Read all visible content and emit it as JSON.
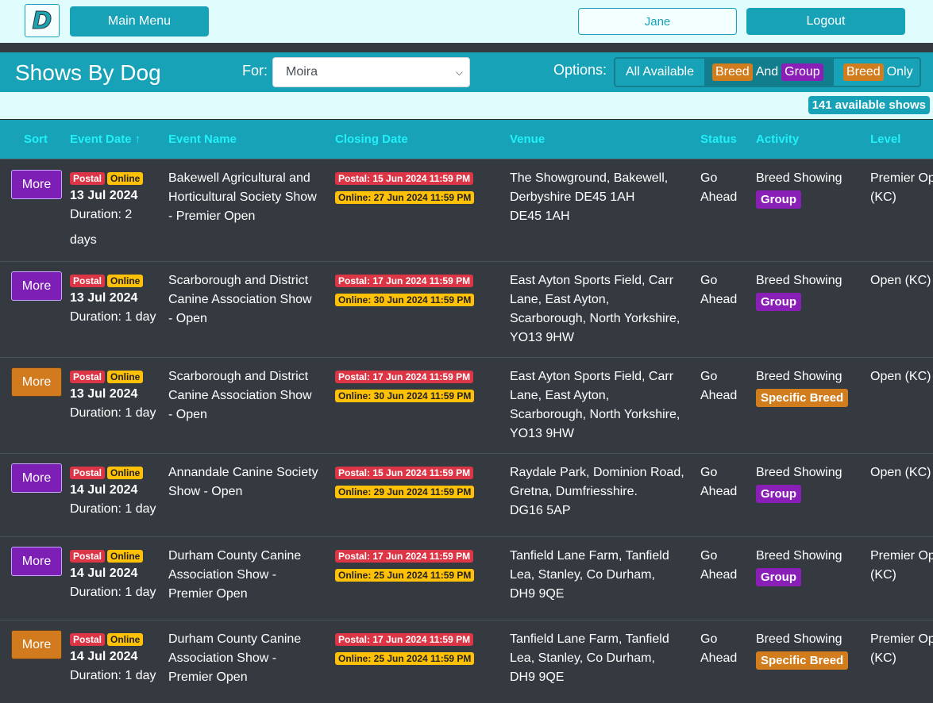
{
  "header": {
    "logo_letter": "D",
    "main_menu_label": "Main Menu",
    "user_label": "Jane",
    "logout_label": "Logout"
  },
  "toolbar": {
    "title": "Shows By Dog",
    "for_label": "For:",
    "dog_selected": "Moira",
    "options_label": "Options:",
    "opt_all": "All Available",
    "opt_breed": "Breed",
    "opt_and": "And",
    "opt_group": "Group",
    "opt_breed2": "Breed",
    "opt_only": "Only"
  },
  "count_badge": "141 available shows",
  "columns": {
    "sort": "Sort",
    "event_date": "Event Date ↑",
    "event_name": "Event Name",
    "closing_date": "Closing Date",
    "venue": "Venue",
    "status": "Status",
    "activity": "Activity",
    "level": "Level"
  },
  "colors": {
    "teal": "#17a2b8",
    "dark": "#343a40",
    "group": "#8a1fb8",
    "breed": "#d27d1d",
    "postal": "#dc3545",
    "online": "#ffc107"
  },
  "rows": [
    {
      "more": "More",
      "more_color": "purple",
      "postal": "Postal",
      "online": "Online",
      "date": "13 Jul 2024",
      "duration": "Duration: 2",
      "duration2": "days",
      "name": [
        "Bakewell Agricultural and",
        "Horticultural Society Show",
        "- Premier Open"
      ],
      "close_postal": "Postal: 15 Jun 2024 11:59 PM",
      "close_online": "Online: 27 Jun 2024 11:59 PM",
      "venue": [
        "The Showground, Bakewell,",
        "Derbyshire DE45 1AH",
        "DE45 1AH"
      ],
      "status": [
        "Go",
        "Ahead"
      ],
      "activity": "Breed Showing",
      "activity_badge": "Group",
      "level": [
        "Premier Open",
        "(KC)"
      ]
    },
    {
      "more": "More",
      "more_color": "purple",
      "postal": "Postal",
      "online": "Online",
      "date": "13 Jul 2024",
      "duration": "Duration: 1 day",
      "name": [
        "Scarborough and District",
        "Canine Association Show",
        "- Open"
      ],
      "close_postal": "Postal: 17 Jun 2024 11:59 PM",
      "close_online": "Online: 30 Jun 2024 11:59 PM",
      "venue": [
        "East Ayton Sports Field, Carr",
        "Lane, East Ayton,",
        "Scarborough, North Yorkshire,",
        "YO13 9HW"
      ],
      "status": [
        "Go",
        "Ahead"
      ],
      "activity": "Breed Showing",
      "activity_badge": "Group",
      "level": [
        "Open (KC)"
      ]
    },
    {
      "more": "More",
      "more_color": "orange",
      "postal": "Postal",
      "online": "Online",
      "date": "13 Jul 2024",
      "duration": "Duration: 1 day",
      "name": [
        "Scarborough and District",
        "Canine Association Show",
        "- Open"
      ],
      "close_postal": "Postal: 17 Jun 2024 11:59 PM",
      "close_online": "Online: 30 Jun 2024 11:59 PM",
      "venue": [
        "East Ayton Sports Field, Carr",
        "Lane, East Ayton,",
        "Scarborough, North Yorkshire,",
        "YO13 9HW"
      ],
      "status": [
        "Go",
        "Ahead"
      ],
      "activity": "Breed Showing",
      "activity_badge": "Specific Breed",
      "level": [
        "Open (KC)"
      ]
    },
    {
      "more": "More",
      "more_color": "purple",
      "postal": "Postal",
      "online": "Online",
      "date": "14 Jul 2024",
      "duration": "Duration: 1 day",
      "name": [
        "Annandale Canine Society",
        "Show - Open"
      ],
      "close_postal": "Postal: 15 Jun 2024 11:59 PM",
      "close_online": "Online: 29 Jun 2024 11:59 PM",
      "venue": [
        "Raydale Park, Dominion Road,",
        "Gretna, Dumfriesshire.",
        "DG16 5AP"
      ],
      "status": [
        "Go",
        "Ahead"
      ],
      "activity": "Breed Showing",
      "activity_badge": "Group",
      "level": [
        "Open (KC)"
      ]
    },
    {
      "more": "More",
      "more_color": "purple",
      "postal": "Postal",
      "online": "Online",
      "date": "14 Jul 2024",
      "duration": "Duration: 1 day",
      "name": [
        "Durham County Canine",
        "Association Show -",
        "Premier Open"
      ],
      "close_postal": "Postal: 17 Jun 2024 11:59 PM",
      "close_online": "Online: 25 Jun 2024 11:59 PM",
      "venue": [
        "Tanfield Lane Farm, Tanfield",
        "Lea, Stanley, Co Durham,",
        "DH9 9QE"
      ],
      "status": [
        "Go",
        "Ahead"
      ],
      "activity": "Breed Showing",
      "activity_badge": "Group",
      "level": [
        "Premier Open",
        "(KC)"
      ]
    },
    {
      "more": "More",
      "more_color": "orange",
      "postal": "Postal",
      "online": "Online",
      "date": "14 Jul 2024",
      "duration": "Duration: 1 day",
      "name": [
        "Durham County Canine",
        "Association Show -",
        "Premier Open"
      ],
      "close_postal": "Postal: 17 Jun 2024 11:59 PM",
      "close_online": "Online: 25 Jun 2024 11:59 PM",
      "venue": [
        "Tanfield Lane Farm, Tanfield",
        "Lea, Stanley, Co Durham,",
        "DH9 9QE"
      ],
      "status": [
        "Go",
        "Ahead"
      ],
      "activity": "Breed Showing",
      "activity_badge": "Specific Breed",
      "level": [
        "Premier Open",
        "(KC)"
      ]
    }
  ]
}
